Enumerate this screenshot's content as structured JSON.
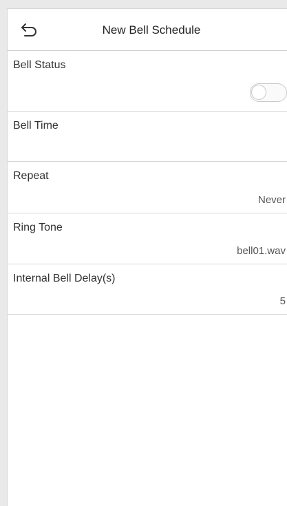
{
  "header": {
    "title": "New Bell Schedule",
    "back_icon": "back-arrow-icon"
  },
  "rows": [
    {
      "label": "Bell Status",
      "value": "",
      "control": "toggle",
      "toggle_on": false
    },
    {
      "label": "Bell Time",
      "value": ""
    },
    {
      "label": "Repeat",
      "value": "Never"
    },
    {
      "label": "Ring Tone",
      "value": "bell01.wav"
    },
    {
      "label": "Internal Bell Delay(s)",
      "value": "5"
    }
  ],
  "colors": {
    "background": "#ffffff",
    "divider": "#d4d4d4",
    "toggle_off": "#c9c9c9"
  }
}
